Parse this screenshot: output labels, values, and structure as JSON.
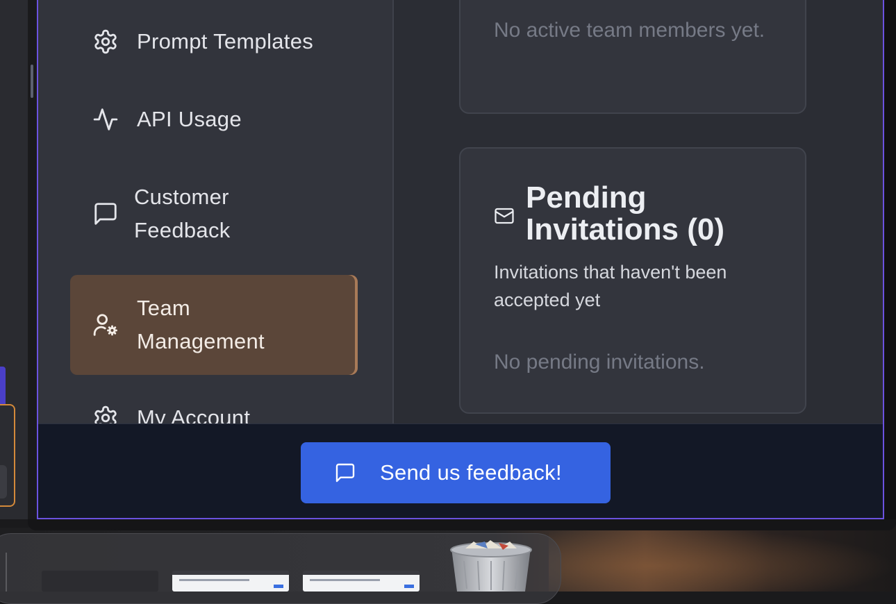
{
  "sidebar": {
    "items": [
      {
        "label": "Prompt Templates",
        "icon": "gear-icon",
        "active": false
      },
      {
        "label": "API Usage",
        "icon": "activity-icon",
        "active": false
      },
      {
        "label": "Customer Feedback",
        "icon": "message-square-icon",
        "active": false
      },
      {
        "label": "Team Management",
        "icon": "user-cog-icon",
        "active": true
      },
      {
        "label": "My Account",
        "icon": "gear-icon",
        "active": false
      }
    ]
  },
  "main": {
    "active_members_empty": "No active team members yet.",
    "pending": {
      "title": "Pending Invitations (0)",
      "description": "Invitations that haven't been accepted yet",
      "empty": "No pending invitations.",
      "icon": "mail-icon"
    }
  },
  "footer": {
    "feedback_label": "Send us feedback!",
    "icon": "message-square-icon"
  },
  "colors": {
    "accent_blue": "#3563e1",
    "active_item_bg": "#5b4639",
    "window_border": "#6b52e0"
  },
  "dock": {
    "items": [
      "app-window-thumbnail",
      "browser-window-thumbnail",
      "browser-window-thumbnail",
      "trash-icon"
    ]
  }
}
